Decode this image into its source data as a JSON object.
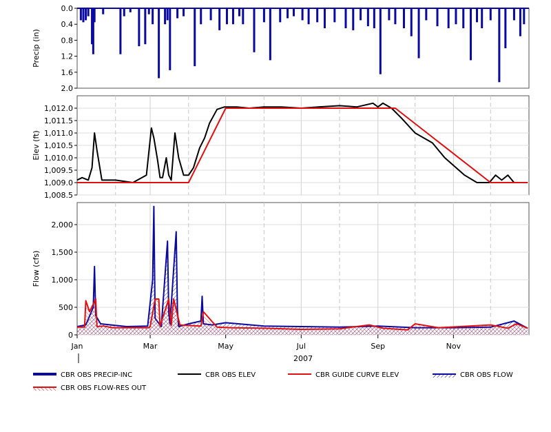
{
  "chart_data": [
    {
      "type": "bar",
      "ylabel": "Precip (in)",
      "y_inverted": true,
      "ylim": [
        0.0,
        2.0
      ],
      "yticks": [
        "0.0",
        "0.4",
        "0.8",
        "1.2",
        "1.6",
        "2.0"
      ],
      "color": "#0a0aa0",
      "series": [
        {
          "name": "CBR OBS PRECIP-INC",
          "x": [
            "2007-01-04",
            "2007-01-06",
            "2007-01-08",
            "2007-01-10",
            "2007-01-13",
            "2007-01-14",
            "2007-01-15",
            "2007-01-22",
            "2007-02-05",
            "2007-02-08",
            "2007-02-13",
            "2007-02-20",
            "2007-02-25",
            "2007-02-28",
            "2007-03-03",
            "2007-03-08",
            "2007-03-13",
            "2007-03-15",
            "2007-03-17",
            "2007-03-23",
            "2007-03-28",
            "2007-04-06",
            "2007-04-11",
            "2007-04-19",
            "2007-04-26",
            "2007-05-02",
            "2007-05-07",
            "2007-05-12",
            "2007-05-15",
            "2007-05-24",
            "2007-06-01",
            "2007-06-06",
            "2007-06-14",
            "2007-06-20",
            "2007-06-25",
            "2007-07-02",
            "2007-07-07",
            "2007-07-14",
            "2007-07-20",
            "2007-07-28",
            "2007-08-06",
            "2007-08-12",
            "2007-08-18",
            "2007-08-24",
            "2007-08-29",
            "2007-09-03",
            "2007-09-10",
            "2007-09-15",
            "2007-09-22",
            "2007-09-28",
            "2007-10-04",
            "2007-10-10",
            "2007-10-19",
            "2007-10-28",
            "2007-11-03",
            "2007-11-09",
            "2007-11-15",
            "2007-11-20",
            "2007-11-24",
            "2007-12-01",
            "2007-12-08",
            "2007-12-13",
            "2007-12-20",
            "2007-12-25",
            "2007-12-28"
          ],
          "values": [
            0.3,
            0.35,
            0.3,
            0.2,
            0.9,
            1.15,
            0.35,
            0.15,
            1.15,
            0.2,
            0.1,
            0.95,
            0.9,
            0.15,
            0.4,
            1.75,
            0.4,
            0.3,
            1.55,
            0.25,
            0.2,
            1.45,
            0.4,
            0.3,
            0.55,
            0.4,
            0.4,
            0.2,
            0.4,
            1.1,
            0.35,
            1.3,
            0.35,
            0.25,
            0.2,
            0.3,
            0.4,
            0.35,
            0.5,
            0.35,
            0.5,
            0.55,
            0.3,
            0.45,
            0.5,
            1.65,
            0.3,
            0.4,
            0.5,
            0.7,
            1.25,
            0.3,
            0.45,
            0.5,
            0.4,
            0.5,
            1.3,
            0.35,
            0.5,
            0.3,
            1.85,
            1.0,
            0.3,
            0.7,
            0.4
          ]
        }
      ]
    },
    {
      "type": "line",
      "ylabel": "Elev (ft)",
      "ylim": [
        1008.5,
        1012.5
      ],
      "yticks": [
        "1,012.0",
        "1,011.5",
        "1,011.0",
        "1,010.5",
        "1,010.0",
        "1,009.5",
        "1,009.0",
        "1,008.5"
      ],
      "series": [
        {
          "name": "CBR OBS ELEV",
          "color": "#000000",
          "x": [
            "2007-01-01",
            "2007-01-05",
            "2007-01-10",
            "2007-01-13",
            "2007-01-15",
            "2007-01-17",
            "2007-01-21",
            "2007-02-01",
            "2007-02-15",
            "2007-02-26",
            "2007-03-02",
            "2007-03-04",
            "2007-03-07",
            "2007-03-09",
            "2007-03-11",
            "2007-03-14",
            "2007-03-16",
            "2007-03-18",
            "2007-03-21",
            "2007-03-24",
            "2007-03-28",
            "2007-04-01",
            "2007-04-05",
            "2007-04-10",
            "2007-04-14",
            "2007-04-18",
            "2007-04-24",
            "2007-04-30",
            "2007-05-04",
            "2007-05-10",
            "2007-05-20",
            "2007-06-01",
            "2007-06-15",
            "2007-07-01",
            "2007-07-15",
            "2007-08-01",
            "2007-08-15",
            "2007-08-28",
            "2007-09-01",
            "2007-09-05",
            "2007-09-12",
            "2007-09-20",
            "2007-10-01",
            "2007-10-15",
            "2007-10-25",
            "2007-11-10",
            "2007-11-20",
            "2007-11-30",
            "2007-12-05",
            "2007-12-10",
            "2007-12-15",
            "2007-12-20",
            "2007-12-25",
            "2007-12-31"
          ],
          "y": [
            1009.1,
            1009.2,
            1009.1,
            1009.6,
            1011.0,
            1010.3,
            1009.1,
            1009.1,
            1009.0,
            1009.3,
            1011.2,
            1010.8,
            1009.9,
            1009.2,
            1009.2,
            1010.0,
            1009.3,
            1009.1,
            1011.0,
            1010.0,
            1009.3,
            1009.3,
            1009.6,
            1010.4,
            1010.8,
            1011.4,
            1011.95,
            1012.05,
            1012.05,
            1012.05,
            1012.0,
            1012.05,
            1012.05,
            1012.0,
            1012.05,
            1012.1,
            1012.05,
            1012.2,
            1012.05,
            1012.2,
            1012.0,
            1011.6,
            1011.0,
            1010.6,
            1010.0,
            1009.3,
            1009.0,
            1009.0,
            1009.3,
            1009.1,
            1009.3,
            1009.0,
            1009.0,
            1009.0
          ]
        },
        {
          "name": "CBR GUIDE CURVE ELEV",
          "color": "#e01010",
          "x": [
            "2007-01-01",
            "2007-04-01",
            "2007-05-01",
            "2007-09-15",
            "2007-12-01",
            "2007-12-31"
          ],
          "y": [
            1009.0,
            1009.0,
            1012.0,
            1012.0,
            1009.0,
            1009.0
          ]
        }
      ]
    },
    {
      "type": "line",
      "ylabel": "Flow (cfs)",
      "ylim": [
        0,
        2400
      ],
      "yticks": [
        "2,000",
        "1,500",
        "1,000",
        "500",
        "0"
      ],
      "xticks": [
        "Jan",
        "Mar",
        "May",
        "Jul",
        "Sep",
        "Nov"
      ],
      "xlabel": "2007",
      "series": [
        {
          "name": "CBR OBS FLOW",
          "color": "#0a0aa0",
          "x": [
            "2007-01-01",
            "2007-01-08",
            "2007-01-14",
            "2007-01-15",
            "2007-01-16",
            "2007-01-20",
            "2007-02-10",
            "2007-02-27",
            "2007-03-03",
            "2007-03-04",
            "2007-03-05",
            "2007-03-10",
            "2007-03-15",
            "2007-03-16",
            "2007-03-17",
            "2007-03-22",
            "2007-03-23",
            "2007-03-24",
            "2007-04-01",
            "2007-04-11",
            "2007-04-12",
            "2007-04-13",
            "2007-04-20",
            "2007-05-01",
            "2007-06-01",
            "2007-07-01",
            "2007-08-01",
            "2007-09-01",
            "2007-10-01",
            "2007-11-01",
            "2007-12-01",
            "2007-12-20",
            "2007-12-31"
          ],
          "y": [
            150,
            180,
            500,
            1240,
            350,
            200,
            150,
            160,
            1000,
            2330,
            300,
            150,
            1700,
            400,
            200,
            1870,
            450,
            150,
            200,
            250,
            700,
            200,
            180,
            220,
            160,
            150,
            140,
            160,
            130,
            130,
            140,
            250,
            120
          ]
        },
        {
          "name": "CBR OBS FLOW-RES OUT",
          "color": "#e01010",
          "x": [
            "2007-01-01",
            "2007-01-07",
            "2007-01-08",
            "2007-01-11",
            "2007-01-16",
            "2007-01-17",
            "2007-01-22",
            "2007-01-30",
            "2007-02-28",
            "2007-03-01",
            "2007-03-05",
            "2007-03-08",
            "2007-03-09",
            "2007-03-16",
            "2007-03-18",
            "2007-03-20",
            "2007-03-25",
            "2007-04-11",
            "2007-04-13",
            "2007-04-24",
            "2007-05-05",
            "2007-06-01",
            "2007-07-01",
            "2007-08-01",
            "2007-08-25",
            "2007-09-05",
            "2007-09-25",
            "2007-10-01",
            "2007-10-20",
            "2007-12-01",
            "2007-12-15",
            "2007-12-22",
            "2007-12-31"
          ],
          "y": [
            140,
            140,
            620,
            420,
            650,
            150,
            160,
            130,
            130,
            150,
            650,
            650,
            160,
            650,
            170,
            650,
            180,
            160,
            420,
            140,
            130,
            120,
            100,
            110,
            180,
            120,
            90,
            200,
            130,
            180,
            120,
            200,
            120
          ]
        }
      ]
    }
  ],
  "legend": [
    {
      "name": "CBR OBS PRECIP-INC",
      "style": "thick-line",
      "color": "#0a0aa0"
    },
    {
      "name": "CBR OBS ELEV",
      "style": "line",
      "color": "#000000"
    },
    {
      "name": "CBR GUIDE CURVE ELEV",
      "style": "line",
      "color": "#e01010"
    },
    {
      "name": "CBR OBS FLOW",
      "style": "hatched-line",
      "color": "#0a0aa0"
    },
    {
      "name": "CBR OBS FLOW-RES OUT",
      "style": "hatched-line",
      "color": "#e01010"
    }
  ]
}
